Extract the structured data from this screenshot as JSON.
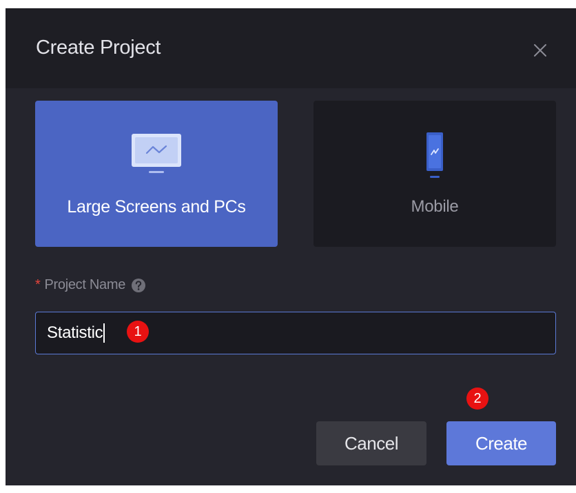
{
  "dialog": {
    "title": "Create Project",
    "close_icon": "close-icon"
  },
  "project_types": [
    {
      "label": "Large Screens and PCs",
      "icon": "monitor-chart-icon",
      "selected": true
    },
    {
      "label": "Mobile",
      "icon": "phone-chart-icon",
      "selected": false
    }
  ],
  "form": {
    "required_mark": "*",
    "name_label": "Project Name",
    "help_icon": "question-circle-icon",
    "name_value": "Statistic"
  },
  "annotations": {
    "step1": "1",
    "step2": "2"
  },
  "buttons": {
    "cancel_label": "Cancel",
    "create_label": "Create"
  },
  "colors": {
    "dialog_bg": "#25252d",
    "header_bg": "#1e1e24",
    "selected_card": "#4b65c3",
    "unselected_card": "#1b1b21",
    "primary": "#5d78d9",
    "badge": "#e81212",
    "required": "#e8453c"
  }
}
